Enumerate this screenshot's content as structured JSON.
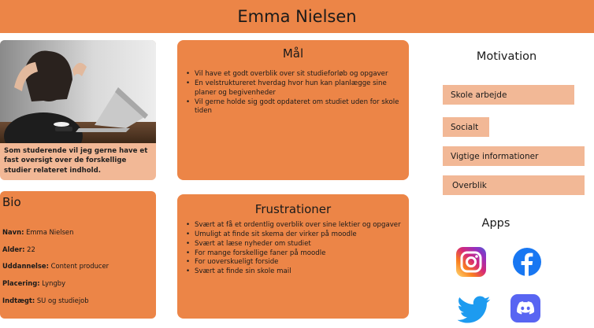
{
  "header": {
    "name": "Emma Nielsen"
  },
  "photo": {
    "caption": "Som studerende vil jeg gerne have et fast oversigt over de forskellige studier relateret indhold."
  },
  "bio": {
    "title": "Bio",
    "items": [
      {
        "key": "Navn:",
        "value": " Emma Nielsen"
      },
      {
        "key": "Alder:",
        "value": " 22"
      },
      {
        "key": "Uddannelse:",
        "value": " Content producer"
      },
      {
        "key": "Placering:",
        "value": "  Lyngby"
      },
      {
        "key": "Indtægt:",
        "value": " SU og studiejob"
      }
    ]
  },
  "goals": {
    "title": "Mål",
    "items": [
      "Vil have et godt overblik over sit studieforløb og opgaver",
      "En velstruktureret hverdag hvor hun kan planlægge sine planer og begivenheder",
      "Vil gerne holde sig godt opdateret om studiet uden for skole tiden"
    ]
  },
  "frustrations": {
    "title": "Frustrationer",
    "items": [
      "Svært at få et ordentlig overblik over sine lektier og opgaver",
      "Umuligt at finde sit skema der virker på moodle",
      "Svært at læse nyheder om studiet",
      "For mange forskellige faner på moodle",
      "For uoverskueligt forside",
      "Svært at finde sin skole mail"
    ]
  },
  "motivation": {
    "title": "Motivation",
    "items": [
      "Skole arbejde",
      "Socialt",
      "Vigtige informationer",
      "Overblik"
    ]
  },
  "apps": {
    "title": "Apps",
    "icons": [
      "instagram-icon",
      "facebook-icon",
      "twitter-icon",
      "discord-icon"
    ]
  },
  "colors": {
    "accent": "#ec8547",
    "accent_light": "#f2b896",
    "instagram_gradient": [
      "#feda75",
      "#fa7e1e",
      "#d62976",
      "#962fbf",
      "#4f5bd5"
    ],
    "facebook": "#1877f2",
    "twitter": "#1d9bf0",
    "discord": "#5865f2"
  }
}
